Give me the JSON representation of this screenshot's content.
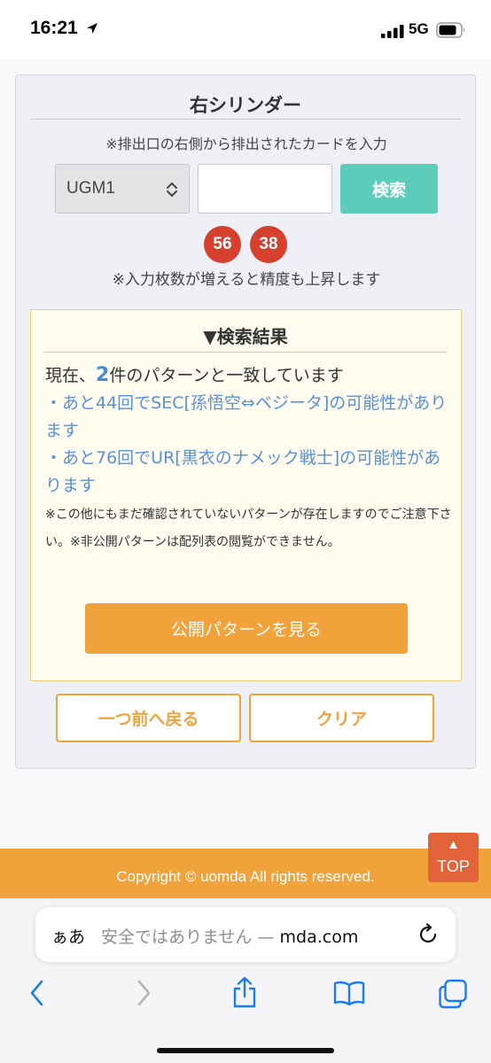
{
  "status_bar": {
    "time": "16:21",
    "network": "5G"
  },
  "panel": {
    "title": "右シリンダー",
    "note": "※排出口の右側から排出されたカードを入力",
    "select": {
      "value": "UGM1"
    },
    "search_input": {
      "value": ""
    },
    "search_button": "検索",
    "badges": [
      "56",
      "38"
    ],
    "note2": "※入力枚数が増えると精度も上昇します"
  },
  "result": {
    "title": "▼検索結果",
    "line1_prefix": "現在、",
    "count": "2",
    "line1_suffix": "件のパターンと一致しています",
    "items": [
      "・あと44回でSEC[孫悟空⇔ベジータ]の可能性があります",
      "・あと76回でUR[黒衣のナメック戦士]の可能性があります"
    ],
    "small_note": "※この他にもまだ確認されていないパターンが存在しますのでご注意下さい。※非公開パターンは配列表の閲覧ができません。",
    "public_button": "公開パターンを見る"
  },
  "buttons": {
    "back": "一つ前へ戻る",
    "clear": "クリア"
  },
  "footer": {
    "copyright": "Copyright © uomda All rights reserved."
  },
  "top_button": {
    "arrow": "▲",
    "label": "TOP"
  },
  "browser": {
    "aa": "ぁあ",
    "url_prefix": "安全ではありません — ",
    "url_domain": "mda.com"
  },
  "colors": {
    "accent_orange": "#f2a23a",
    "teal": "#5ccdbb",
    "badge_red": "#d6402e",
    "link_blue": "#5b8fd9",
    "ios_blue": "#1a7cf5"
  },
  "icons": [
    "location-arrow-icon",
    "signal-icon",
    "battery-icon",
    "chevron-updown-icon",
    "reload-icon",
    "back-icon",
    "forward-icon",
    "share-icon",
    "bookmarks-icon",
    "tabs-icon"
  ]
}
